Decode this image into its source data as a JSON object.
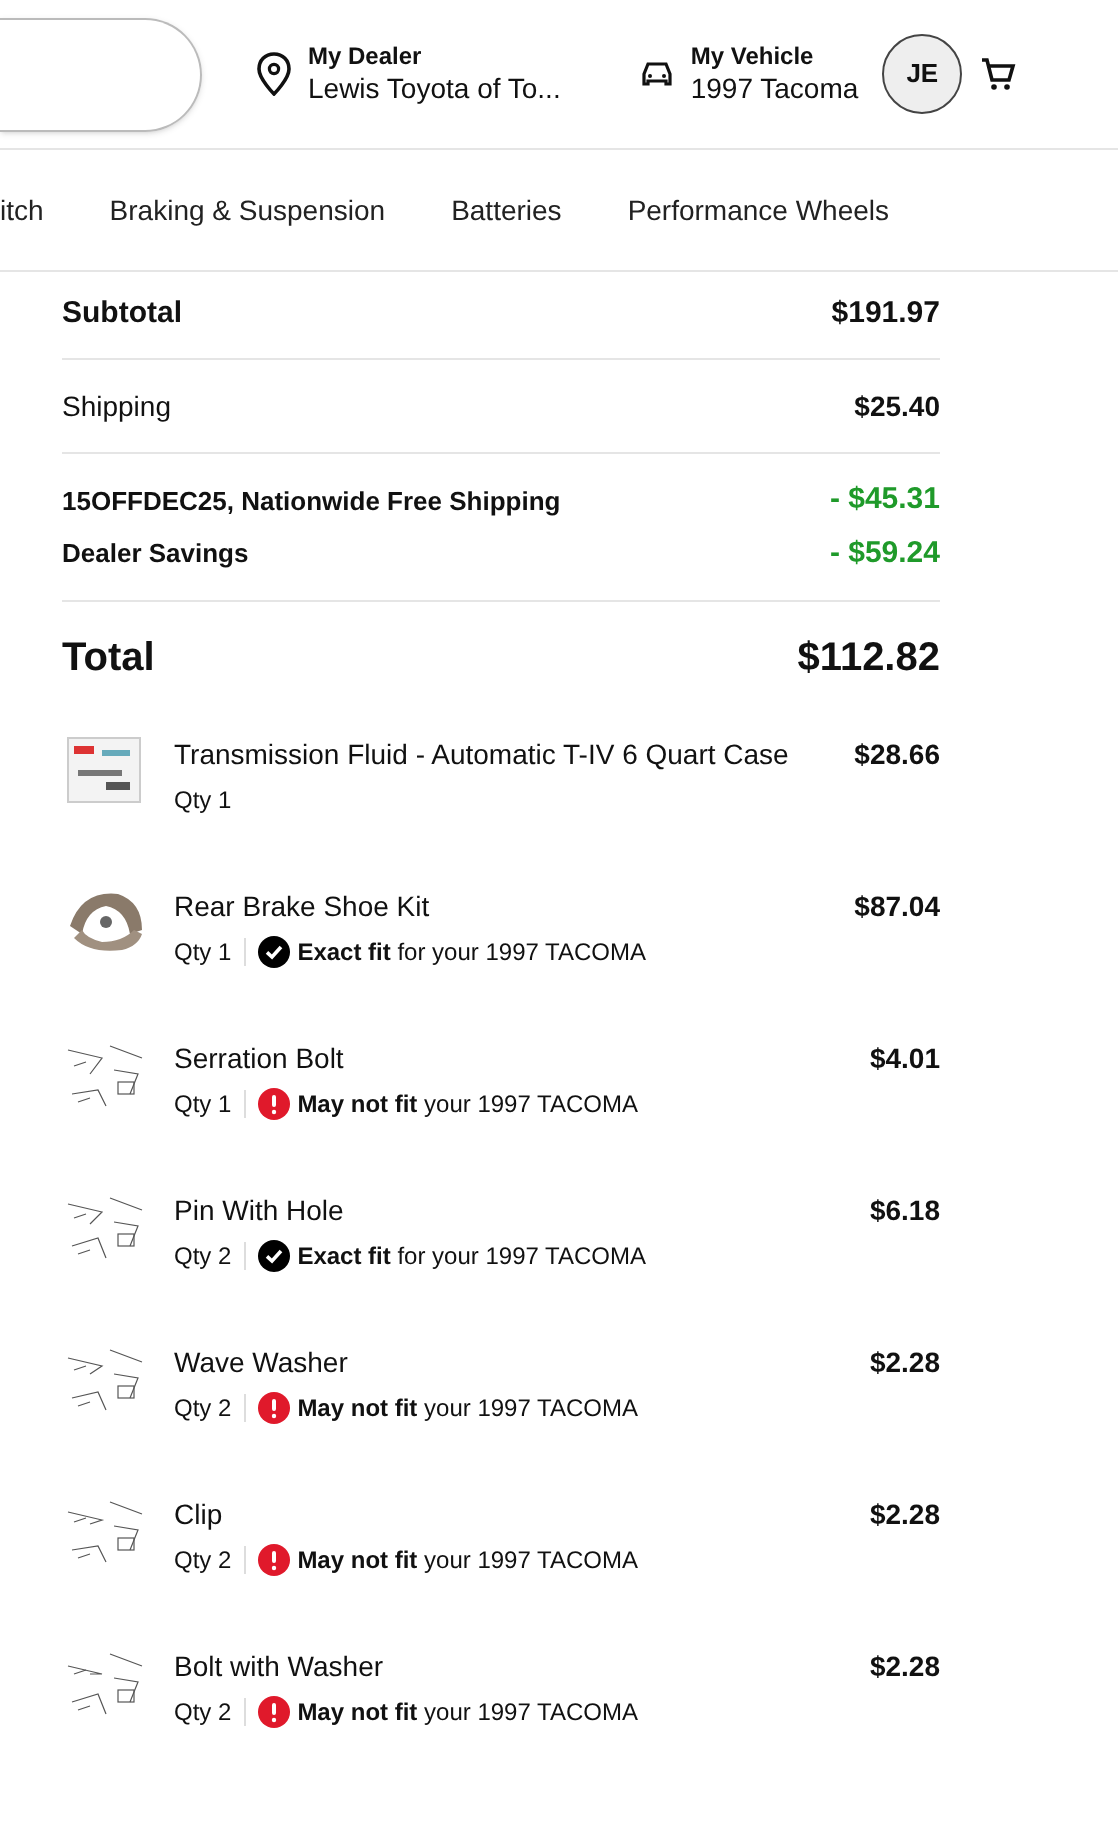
{
  "header": {
    "dealer": {
      "label": "My Dealer",
      "value": "Lewis Toyota of To..."
    },
    "vehicle": {
      "label": "My Vehicle",
      "value": "1997 Tacoma"
    },
    "avatar": "JE"
  },
  "nav": [
    "itch",
    "Braking & Suspension",
    "Batteries",
    "Performance Wheels"
  ],
  "summary": {
    "subtotal": {
      "label": "Subtotal",
      "value": "$191.97"
    },
    "shipping": {
      "label": "Shipping",
      "value": "$25.40"
    },
    "discounts": [
      {
        "label": "15OFFDEC25, Nationwide Free Shipping",
        "value": "- $45.31"
      },
      {
        "label": "Dealer Savings",
        "value": "- $59.24"
      }
    ],
    "total": {
      "label": "Total",
      "value": "$112.82"
    }
  },
  "items": [
    {
      "name": "Transmission Fluid - Automatic T-IV 6 Quart Case",
      "qty": "Qty 1",
      "price": "$28.66",
      "kind": "plain"
    },
    {
      "name": "Rear Brake Shoe Kit",
      "qty": "Qty 1",
      "price": "$87.04",
      "kind": "exact",
      "fit_label": "Exact fit",
      "fit_text": "for your 1997 TACOMA"
    },
    {
      "name": "Serration Bolt",
      "qty": "Qty 1",
      "price": "$4.01",
      "kind": "maybe",
      "fit_label": "May not fit",
      "fit_text": "your 1997 TACOMA"
    },
    {
      "name": "Pin With Hole",
      "qty": "Qty 2",
      "price": "$6.18",
      "kind": "exact",
      "fit_label": "Exact fit",
      "fit_text": "for your 1997 TACOMA"
    },
    {
      "name": "Wave Washer",
      "qty": "Qty 2",
      "price": "$2.28",
      "kind": "maybe",
      "fit_label": "May not fit",
      "fit_text": "your 1997 TACOMA"
    },
    {
      "name": "Clip",
      "qty": "Qty 2",
      "price": "$2.28",
      "kind": "maybe",
      "fit_label": "May not fit",
      "fit_text": "your 1997 TACOMA"
    },
    {
      "name": "Bolt with Washer",
      "qty": "Qty 2",
      "price": "$2.28",
      "kind": "maybe",
      "fit_label": "May not fit",
      "fit_text": "your 1997 TACOMA"
    }
  ]
}
